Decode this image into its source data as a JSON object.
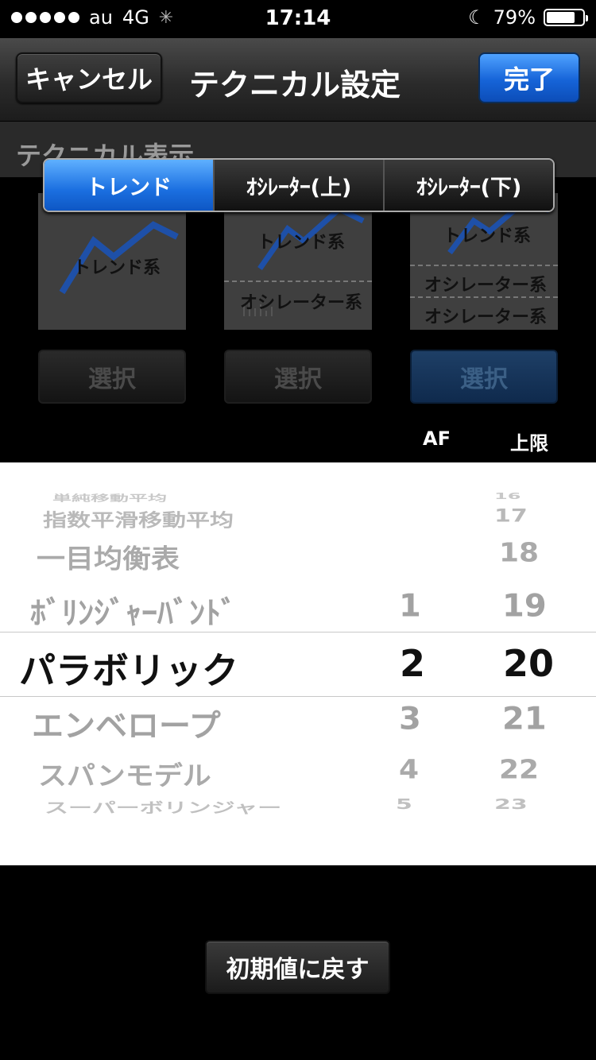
{
  "status": {
    "carrier": "au",
    "network": "4G",
    "time": "17:14",
    "battery": "79%",
    "battery_level": 0.79
  },
  "nav": {
    "cancel": "キャンセル",
    "title": "テクニカル設定",
    "done": "完了"
  },
  "section": {
    "title": "テクニカル表示"
  },
  "segments": [
    "トレンド",
    "ｵｼﾚｰﾀｰ(上)",
    "ｵｼﾚｰﾀｰ(下)"
  ],
  "thumbnails": {
    "trend": "トレンド系",
    "oscillator": "オシレーター系"
  },
  "select_label": "選択",
  "columns": {
    "af": "AF",
    "upper": "上限"
  },
  "picker": {
    "names": [
      "単純移動平均",
      "指数平滑移動平均",
      "一目均衡表",
      "ﾎﾞﾘﾝｼﾞｬｰﾊﾞﾝﾄﾞ",
      "パラボリック",
      "エンベロープ",
      "スパンモデル",
      "スーパーボリンジャー"
    ],
    "af": [
      "",
      "",
      "",
      "1",
      "2",
      "3",
      "4",
      "5"
    ],
    "upper": [
      "16",
      "17",
      "18",
      "19",
      "20",
      "21",
      "22",
      "23"
    ]
  },
  "reset": "初期値に戻す"
}
